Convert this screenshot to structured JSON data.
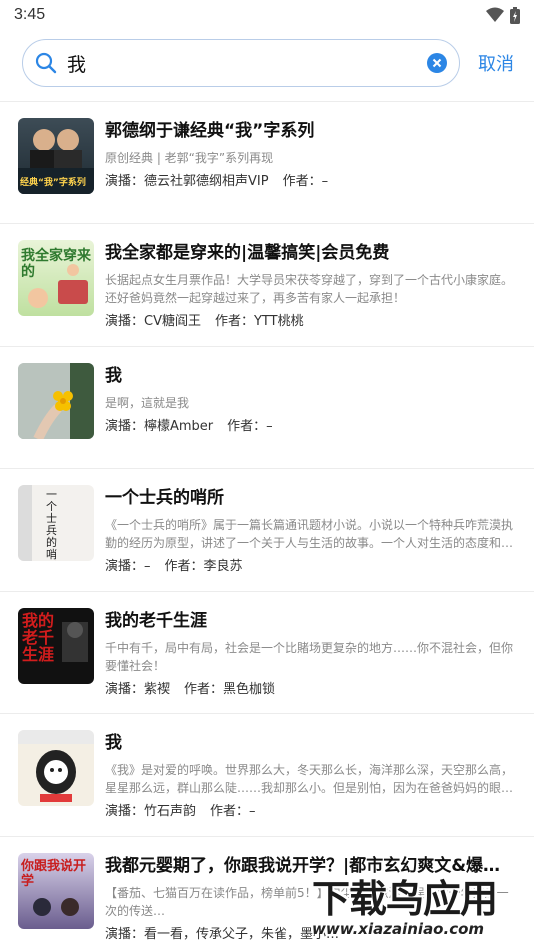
{
  "status": {
    "time": "3:45"
  },
  "search": {
    "value": "我",
    "cancel_label": "取消"
  },
  "results": [
    {
      "title": "郭德纲于谦经典“我”字系列",
      "desc": "原创经典 | 老郭“我字”系列再现",
      "performer_label": "演播：德云社郭德纲相声VIP",
      "author_label": "作者：–",
      "cover_text": "经典“我”字系列"
    },
    {
      "title": "我全家都是穿来的|温馨搞笑|会员免费",
      "desc": "长据起点女生月票作品！大学导员宋茯苓穿越了，穿到了一个古代小康家庭。还好爸妈竟然一起穿越过来了，再多苦有家人一起承担！",
      "performer_label": "演播：CV糖阎王",
      "author_label": "作者：YTT桃桃",
      "cover_text": "我全家穿来的"
    },
    {
      "title": "我",
      "desc": "是啊，這就是我",
      "performer_label": "演播：檸檬Amber",
      "author_label": "作者：–",
      "cover_text": ""
    },
    {
      "title": "一个士兵的哨所",
      "desc": "《一个士兵的哨所》属于一篇长篇通讯题材小说。小说以一个特种兵咋荒漠执勤的经历为原型，讲述了一个关于人与生活的故事。一个人对生活的态度和…",
      "performer_label": "演播：–",
      "author_label": "作者：李良苏",
      "cover_text": "一个士兵的哨所"
    },
    {
      "title": "我的老千生涯",
      "desc": "千中有千，局中有局，社会是一个比賭场更复杂的地方……你不混社会，但你要懂社会！",
      "performer_label": "演播：紫褉",
      "author_label": "作者：黑色枷锁",
      "cover_text": "我的老千生涯"
    },
    {
      "title": "我",
      "desc": "《我》是对爱的呼唤。世界那么大，冬天那么长，海洋那么深，天空那么高，星星那么远，群山那么陡……我却那么小。但是别怕，因为在爸爸妈妈的眼中…",
      "performer_label": "演播：竹石声韵",
      "author_label": "作者：–",
      "cover_text": ""
    },
    {
      "title": "我都元婴期了，你跟我说开学？|都市玄幻爽文&爆…",
      "desc": "【番茄、七猫百万在读作品，榜单前5！】宁尘暑假旅游，误入两千年开启一次的传送…",
      "performer_label": "演播：看一看，传承父子，朱雀，墨小…",
      "author_label": "",
      "cover_text": "你跟我说开学"
    }
  ],
  "watermark": {
    "main": "下载鸟应用",
    "url": "www.xiazainiao.com"
  },
  "colors": {
    "accent": "#2c86e5",
    "search_border": "#b9cde8"
  }
}
